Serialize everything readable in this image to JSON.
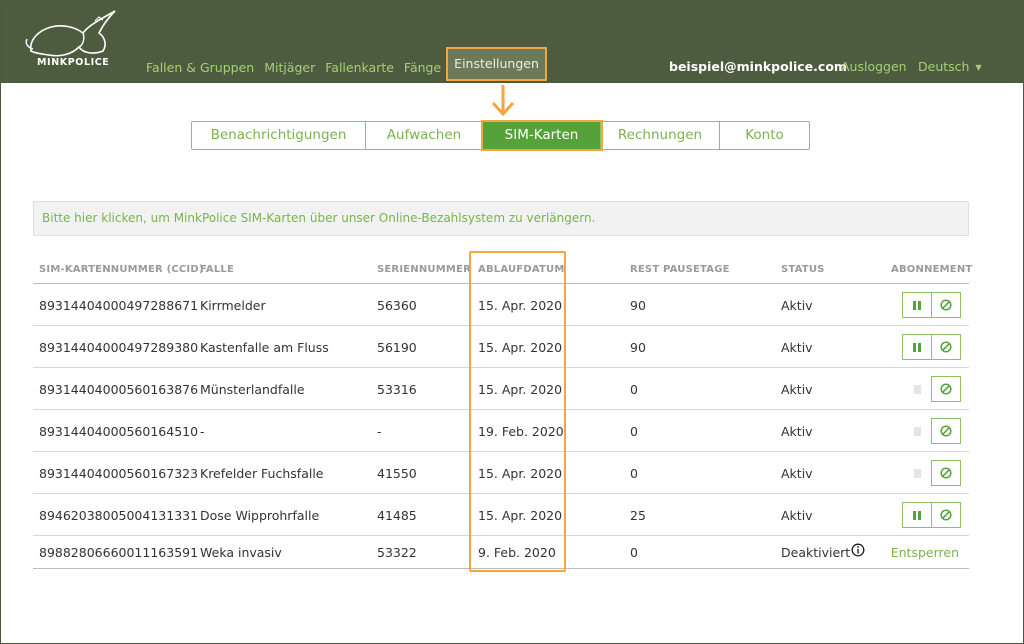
{
  "brand": {
    "name": "MINKPOLICE"
  },
  "nav": {
    "items": [
      "Fallen & Gruppen",
      "Mitjäger",
      "Fallenkarte",
      "Fänge",
      "Einstellungen"
    ],
    "active": "Einstellungen"
  },
  "user": {
    "email": "beispiel@minkpolice.com",
    "logout": "Ausloggen",
    "language": "Deutsch"
  },
  "subtabs": {
    "items": [
      "Benachrichtigungen",
      "Aufwachen",
      "SIM-Karten",
      "Rechnungen",
      "Konto"
    ],
    "active": "SIM-Karten"
  },
  "notice": "Bitte hier klicken, um MinkPolice SIM-Karten über unser Online-Bezahlsystem zu verlängern.",
  "table": {
    "headers": [
      "SIM-KARTENNUMMER (CCID)",
      "FALLE",
      "SERIENNUMMER",
      "ABLAUFDATUM",
      "REST PAUSETAGE",
      "STATUS",
      "ABONNEMENT"
    ],
    "rows": [
      {
        "ccid": "89314404000497288671",
        "falle": "Kirrmelder",
        "serien": "56360",
        "ablauf": "15. Apr. 2020",
        "rest": "90",
        "status": "Aktiv",
        "pause": "enabled"
      },
      {
        "ccid": "89314404000497289380",
        "falle": "Kastenfalle am Fluss",
        "serien": "56190",
        "ablauf": "15. Apr. 2020",
        "rest": "90",
        "status": "Aktiv",
        "pause": "enabled"
      },
      {
        "ccid": "89314404000560163876",
        "falle": "Münsterlandfalle",
        "serien": "53316",
        "ablauf": "15. Apr. 2020",
        "rest": "0",
        "status": "Aktiv",
        "pause": "disabled"
      },
      {
        "ccid": "89314404000560164510",
        "falle": "-",
        "serien": "-",
        "ablauf": "19. Feb. 2020",
        "rest": "0",
        "status": "Aktiv",
        "pause": "disabled"
      },
      {
        "ccid": "89314404000560167323",
        "falle": "Krefelder Fuchsfalle",
        "serien": "41550",
        "ablauf": "15. Apr. 2020",
        "rest": "0",
        "status": "Aktiv",
        "pause": "disabled"
      },
      {
        "ccid": "89462038005004131331",
        "falle": "Dose Wipprohrfalle",
        "serien": "41485",
        "ablauf": "15. Apr. 2020",
        "rest": "25",
        "status": "Aktiv",
        "pause": "enabled"
      },
      {
        "ccid": "89882806660011163591",
        "falle": "Weka invasiv",
        "serien": "53322",
        "ablauf": "9. Feb. 2020",
        "rest": "0",
        "status": "Deaktiviert",
        "action": "Entsperren"
      }
    ]
  },
  "colors": {
    "header": "#4d5c3e",
    "accent": "#56a23a",
    "link": "#7ab34f",
    "highlight": "#f2a640"
  }
}
